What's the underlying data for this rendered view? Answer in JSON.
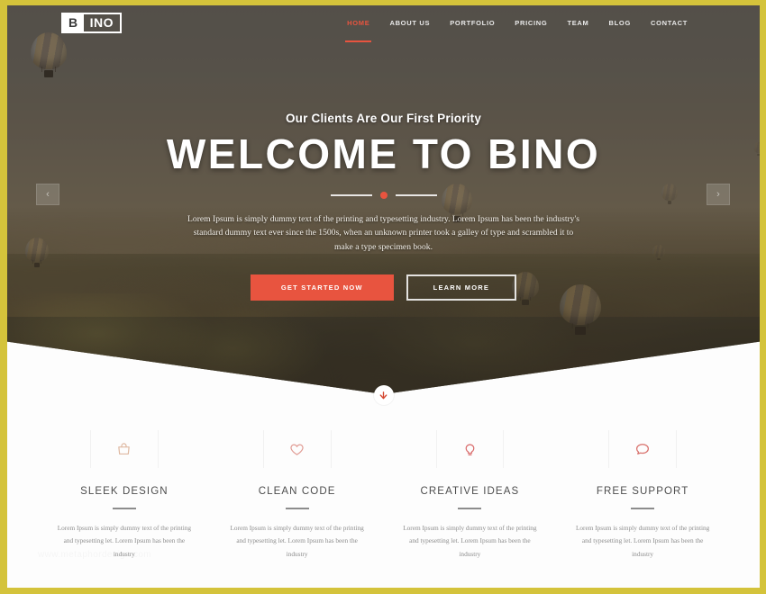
{
  "brand": {
    "logo_mark": "B",
    "logo_text": "INO"
  },
  "nav": {
    "items": [
      {
        "label": "HOME",
        "active": true
      },
      {
        "label": "ABOUT US",
        "active": false
      },
      {
        "label": "PORTFOLIO",
        "active": false
      },
      {
        "label": "PRICING",
        "active": false
      },
      {
        "label": "TEAM",
        "active": false
      },
      {
        "label": "BLOG",
        "active": false
      },
      {
        "label": "CONTACT",
        "active": false
      }
    ]
  },
  "hero": {
    "subtitle": "Our Clients Are Our First Priority",
    "title": "WELCOME TO BINO",
    "paragraph": "Lorem Ipsum is simply dummy text of the printing and typesetting industry. Lorem Ipsum has been the industry's standard dummy text ever since the 1500s, when an unknown printer took a galley of type and scrambled it to make a type specimen book.",
    "primary_button": "GET STARTED NOW",
    "secondary_button": "LEARN MORE",
    "prev_arrow": "‹",
    "next_arrow": "›"
  },
  "features": {
    "items": [
      {
        "icon": "shopping-bag-icon",
        "title": "SLEEK DESIGN",
        "text": "Lorem Ipsum is simply dummy text of the printing and typesetting let. Lorem Ipsum has been the industry"
      },
      {
        "icon": "heart-icon",
        "title": "CLEAN CODE",
        "text": "Lorem Ipsum is simply dummy text of the printing and typesetting let. Lorem Ipsum has been the industry"
      },
      {
        "icon": "lightbulb-icon",
        "title": "CREATIVE IDEAS",
        "text": "Lorem Ipsum is simply dummy text of the printing and typesetting let. Lorem Ipsum has been the industry"
      },
      {
        "icon": "support-chat-icon",
        "title": "FREE SUPPORT",
        "text": "Lorem Ipsum is simply dummy text of the printing and typesetting let. Lorem Ipsum has been the industry"
      }
    ]
  },
  "watermark": {
    "text": "www.metaphordesign.com"
  },
  "colors": {
    "accent": "#e8543f",
    "frame": "#d4c33b",
    "page_bg": "#fdfdfd",
    "heading": "#4d4d4d",
    "body_text": "#8d8d8d"
  }
}
